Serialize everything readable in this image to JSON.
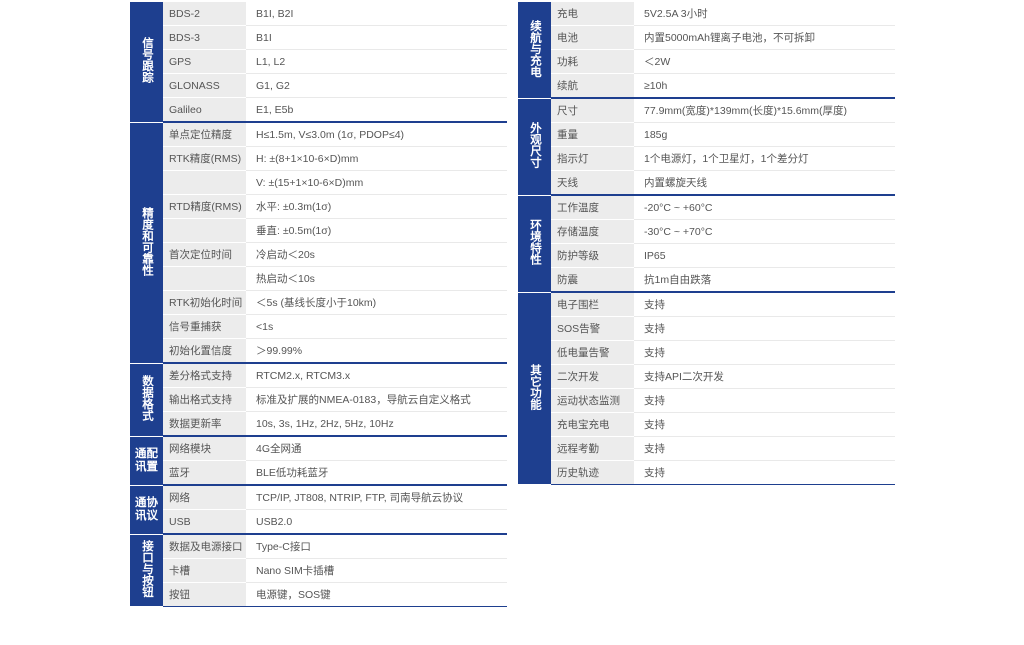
{
  "left_groups": [
    {
      "title": "信号跟踪",
      "layout": "v",
      "rows": [
        {
          "label": "BDS-2",
          "value": "B1I, B2I"
        },
        {
          "label": "BDS-3",
          "value": "B1I"
        },
        {
          "label": "GPS",
          "value": "L1, L2"
        },
        {
          "label": "GLONASS",
          "value": "G1, G2"
        },
        {
          "label": "Galileo",
          "value": "E1, E5b"
        }
      ]
    },
    {
      "title": "精度和可靠性",
      "layout": "v",
      "rows": [
        {
          "label": "单点定位精度",
          "value": "H≤1.5m, V≤3.0m (1σ, PDOP≤4)"
        },
        {
          "label": "RTK精度(RMS)",
          "value": "H: ±(8+1×10-6×D)mm"
        },
        {
          "label": "",
          "value": "V: ±(15+1×10-6×D)mm"
        },
        {
          "label": "RTD精度(RMS)",
          "value": "水平: ±0.3m(1σ)"
        },
        {
          "label": "",
          "value": "垂直: ±0.5m(1σ)"
        },
        {
          "label": "首次定位时间",
          "value": "冷启动＜20s"
        },
        {
          "label": "",
          "value": "热启动＜10s"
        },
        {
          "label": "RTK初始化时间",
          "value": "＜5s (基线长度小于10km)"
        },
        {
          "label": "信号重捕获",
          "value": "<1s"
        },
        {
          "label": "初始化置信度",
          "value": "＞99.99%"
        }
      ]
    },
    {
      "title": "数据格式",
      "layout": "v",
      "rows": [
        {
          "label": "差分格式支持",
          "value": "RTCM2.x, RTCM3.x"
        },
        {
          "label": "输出格式支持",
          "value": "标准及扩展的NMEA-0183，导航云自定义格式"
        },
        {
          "label": "数据更新率",
          "value": "10s, 3s, 1Hz, 2Hz, 5Hz, 10Hz"
        }
      ]
    },
    {
      "title": "通配讯置",
      "layout": "h2",
      "rows": [
        {
          "label": "网络模块",
          "value": "4G全网通"
        },
        {
          "label": "蓝牙",
          "value": "BLE低功耗蓝牙"
        }
      ]
    },
    {
      "title": "通协讯议",
      "layout": "h2",
      "rows": [
        {
          "label": "网络",
          "value": "TCP/IP, JT808, NTRIP, FTP, 司南导航云协议"
        },
        {
          "label": "USB",
          "value": "USB2.0"
        }
      ]
    },
    {
      "title": "接口与按钮",
      "layout": "v",
      "rows": [
        {
          "label": "数据及电源接口",
          "value": "Type-C接口"
        },
        {
          "label": "卡槽",
          "value": "Nano SIM卡插槽"
        },
        {
          "label": "按钮",
          "value": "电源键，SOS键"
        }
      ]
    }
  ],
  "right_groups": [
    {
      "title": "续航与充电",
      "layout": "v",
      "rows": [
        {
          "label": "充电",
          "value": "5V2.5A  3小时"
        },
        {
          "label": "电池",
          "value": "内置5000mAh锂离子电池，不可拆卸"
        },
        {
          "label": "功耗",
          "value": "＜2W"
        },
        {
          "label": "续航",
          "value": "≥10h"
        }
      ]
    },
    {
      "title": "外观尺寸",
      "layout": "v",
      "rows": [
        {
          "label": "尺寸",
          "value": "77.9mm(宽度)*139mm(长度)*15.6mm(厚度)"
        },
        {
          "label": "重量",
          "value": "185g"
        },
        {
          "label": "指示灯",
          "value": "1个电源灯，1个卫星灯，1个差分灯"
        },
        {
          "label": "天线",
          "value": "内置螺旋天线"
        }
      ]
    },
    {
      "title": "环境特性",
      "layout": "v",
      "rows": [
        {
          "label": "工作温度",
          "value": "-20°C ~ +60°C"
        },
        {
          "label": "存储温度",
          "value": "-30°C ~ +70°C"
        },
        {
          "label": "防护等级",
          "value": "IP65"
        },
        {
          "label": "防震",
          "value": "抗1m自由跌落"
        }
      ]
    },
    {
      "title": "其它功能",
      "layout": "v",
      "rows": [
        {
          "label": "电子围栏",
          "value": "支持"
        },
        {
          "label": "SOS告警",
          "value": "支持"
        },
        {
          "label": "低电量告警",
          "value": "支持"
        },
        {
          "label": "二次开发",
          "value": "支持API二次开发"
        },
        {
          "label": "运动状态监测",
          "value": "支持"
        },
        {
          "label": "充电宝充电",
          "value": "支持"
        },
        {
          "label": "远程考勤",
          "value": "支持"
        },
        {
          "label": "历史轨迹",
          "value": "支持"
        }
      ]
    }
  ]
}
